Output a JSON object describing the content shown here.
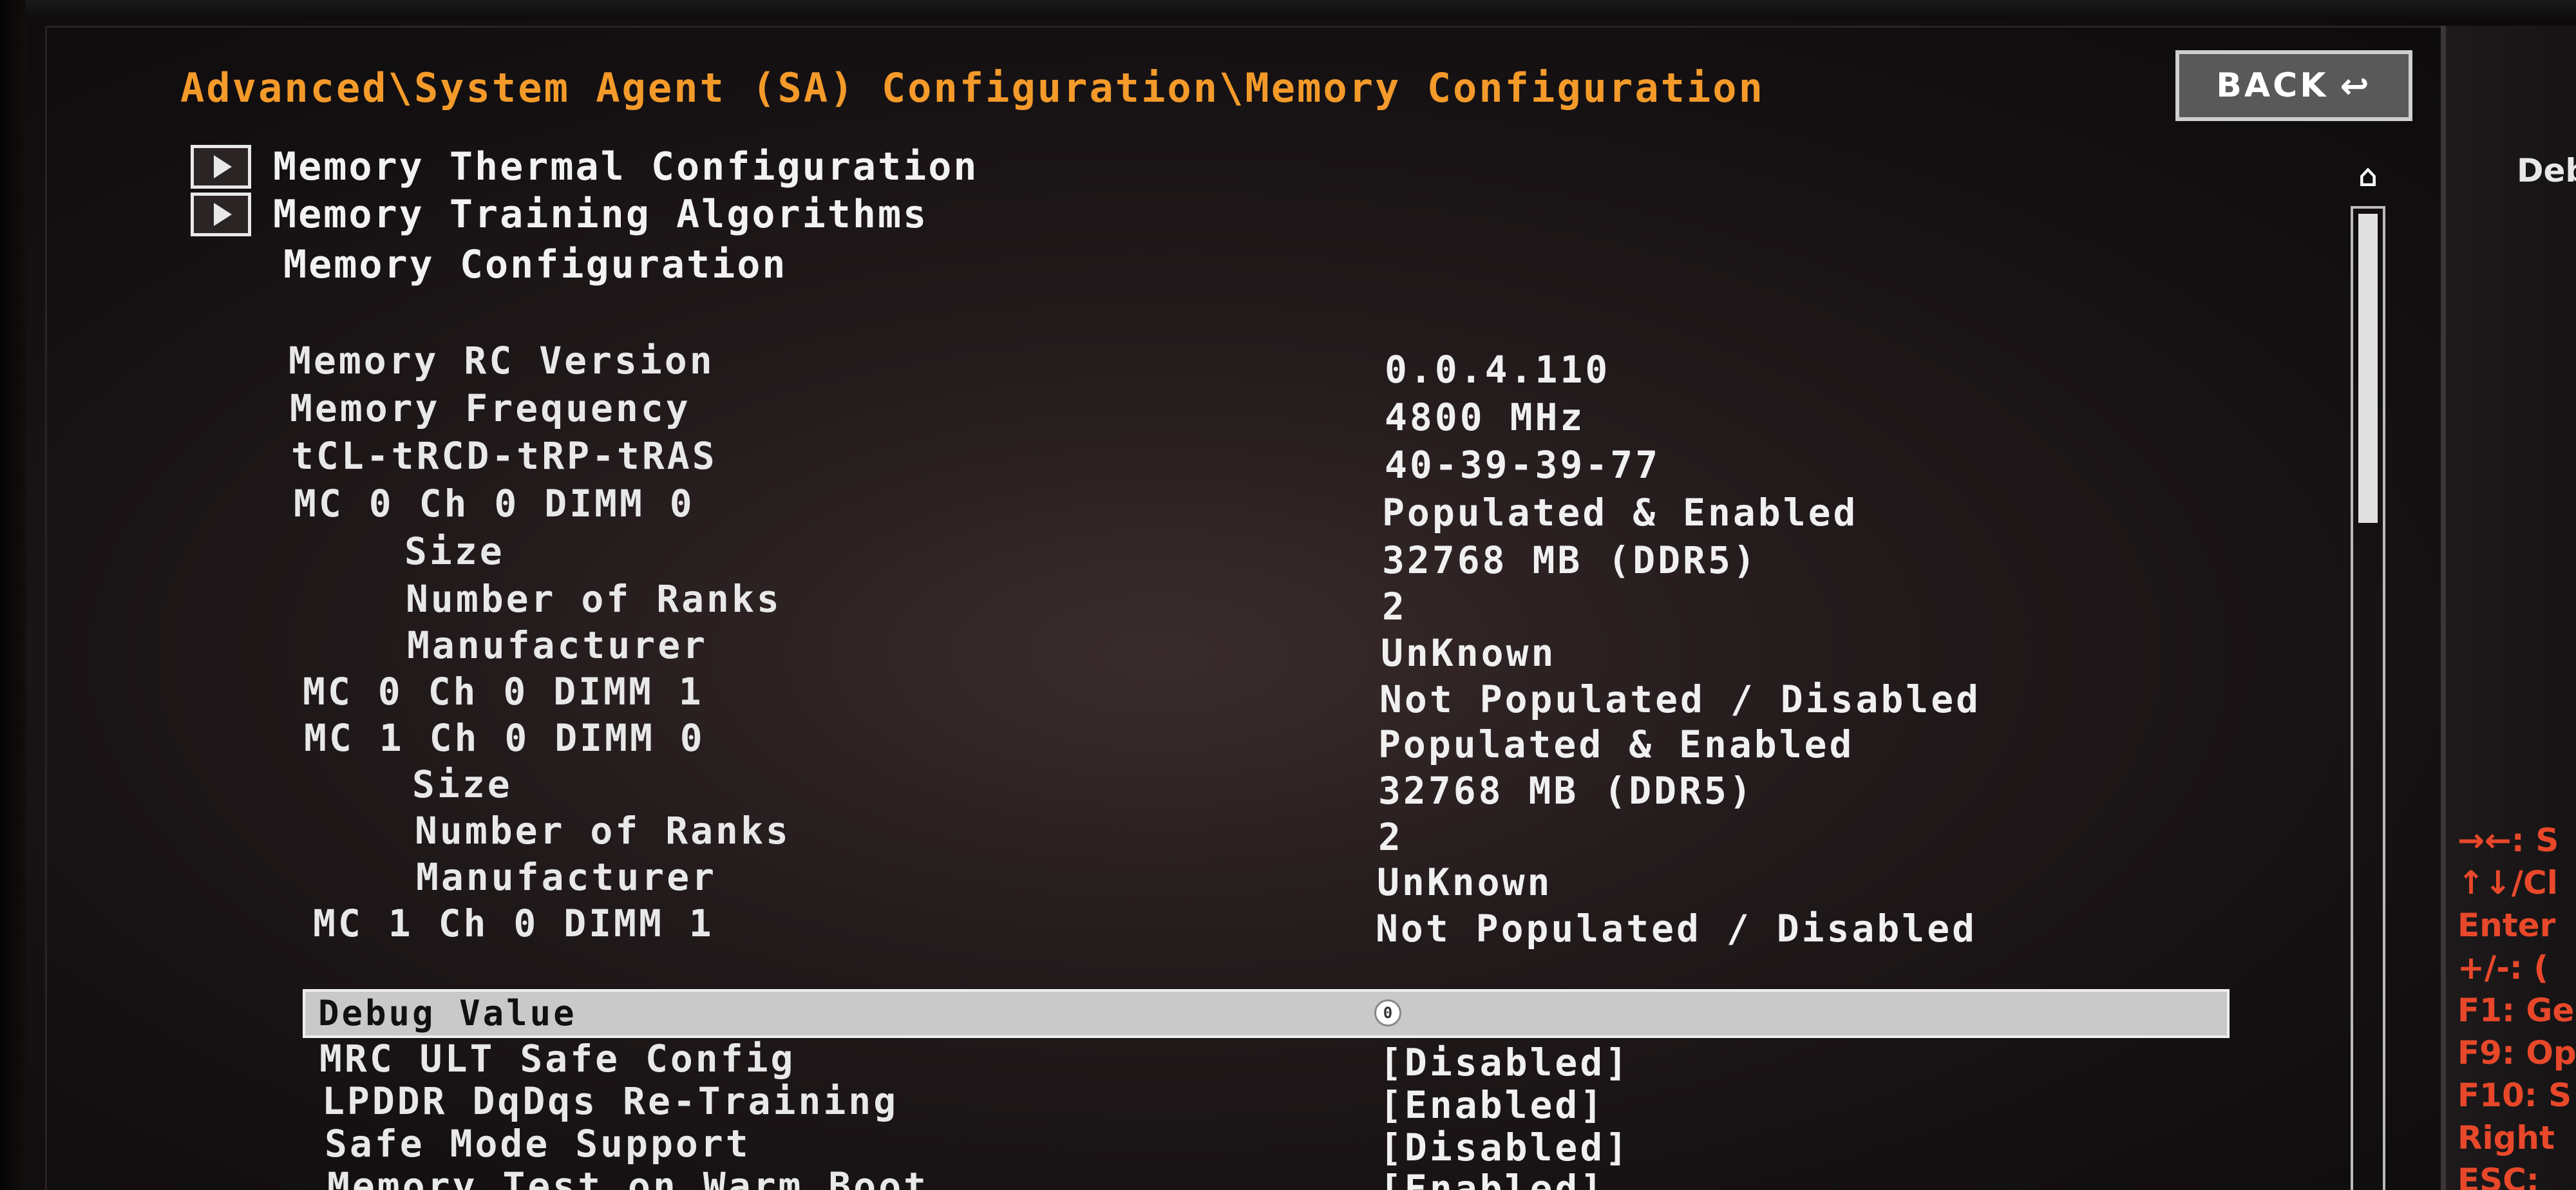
{
  "breadcrumb": "Advanced\\System Agent (SA) Configuration\\Memory Configuration",
  "back_button": {
    "label": "BACK",
    "icon": "return-arrow-icon",
    "icon_glyph": "↩"
  },
  "submenus": [
    {
      "label": "Memory Thermal Configuration",
      "icon": "submenu-arrow-icon"
    },
    {
      "label": "Memory Training Algorithms",
      "icon": "submenu-arrow-icon"
    }
  ],
  "section_title": "Memory Configuration",
  "info_rows": [
    {
      "label": "Memory RC Version",
      "value": "0.0.4.110"
    },
    {
      "label": "Memory Frequency",
      "value": " 4800 MHz"
    },
    {
      "label": "tCL-tRCD-tRP-tRAS",
      "value": "40-39-39-77"
    },
    {
      "label": "MC 0 Ch 0 DIMM 0",
      "value": "Populated & Enabled"
    },
    {
      "label": "Size",
      "value": "32768 MB (DDR5)"
    },
    {
      "label": "Number of Ranks",
      "value": "2"
    },
    {
      "label": "Manufacturer",
      "value": "UnKnown"
    },
    {
      "label": "MC 0 Ch 0 DIMM 1",
      "value": "Not Populated / Disabled"
    },
    {
      "label": "MC 1 Ch 0 DIMM 0",
      "value": "Populated & Enabled"
    },
    {
      "label": "Size",
      "value": "32768 MB (DDR5)"
    },
    {
      "label": "Number of Ranks",
      "value": "2"
    },
    {
      "label": "Manufacturer",
      "value": "UnKnown"
    },
    {
      "label": "MC 1 Ch 0 DIMM 1",
      "value": "Not Populated / Disabled"
    }
  ],
  "selected_setting": {
    "label": "Debug Value",
    "value": "0"
  },
  "settings": [
    {
      "label": "MRC ULT Safe Config",
      "value": "[Disabled]"
    },
    {
      "label": "LPDDR DqDqs Re-Training",
      "value": "[Enabled]"
    },
    {
      "label": "Safe Mode Support",
      "value": "[Disabled]"
    },
    {
      "label": "Memory Test on Warm Boot",
      "value": "[Enabled]"
    }
  ],
  "scrollbar": {
    "up_icon": "scroll-up-icon",
    "up_glyph": "⌂"
  },
  "help_panel": {
    "description": "Deb",
    "key_hints": [
      "→←: S",
      "↑↓/Cl",
      "Enter",
      "+/-: (",
      "F1: Ge",
      "F9: Op",
      "F10: S",
      "Right",
      "ESC: "
    ]
  },
  "colors": {
    "breadcrumb": "#f39a2a",
    "key_hints": "#e8482a",
    "text": "#e8e8e8",
    "highlight": "#c9c9c9"
  }
}
